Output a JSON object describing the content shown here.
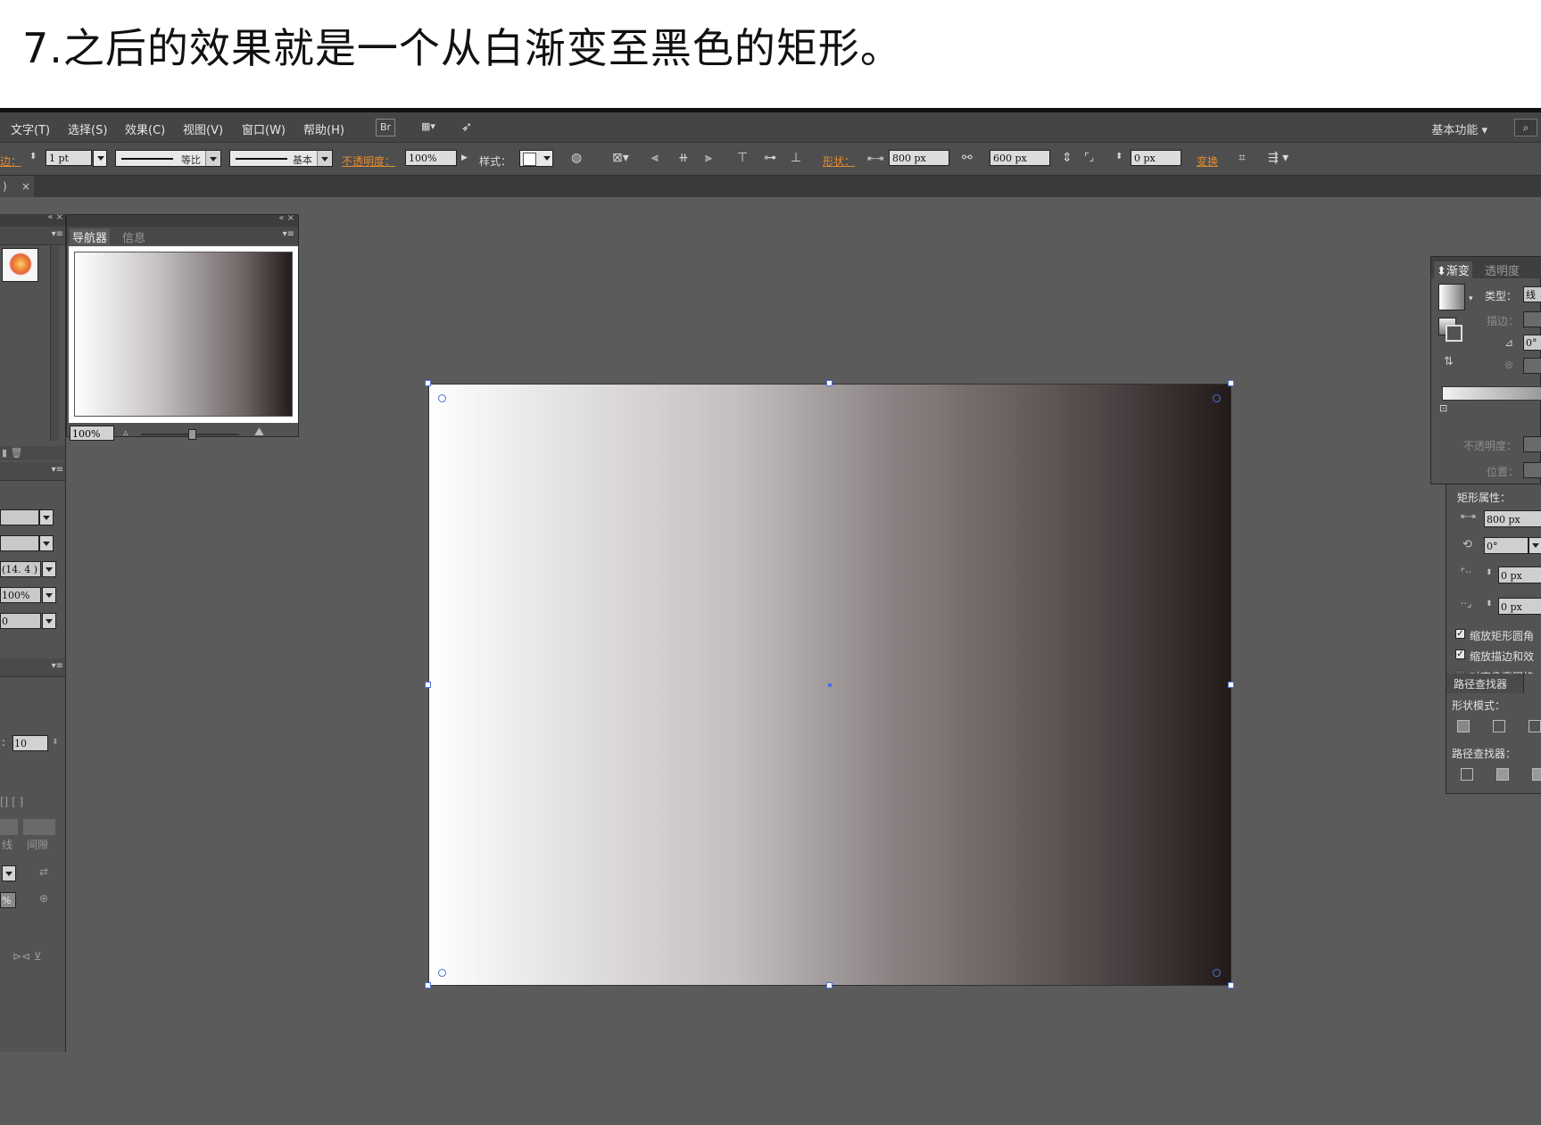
{
  "caption": "7.之后的效果就是一个从白渐变至黑色的矩形。",
  "menu": {
    "items": [
      "文字(T)",
      "选择(S)",
      "效果(C)",
      "视图(V)",
      "窗口(W)",
      "帮助(H)"
    ],
    "bridge": "Br",
    "workspace": "基本功能"
  },
  "control": {
    "stroke_label": "边：",
    "stroke_weight": "1 pt",
    "profile_label": "等比",
    "brush_label": "基本",
    "opacity_label": "不透明度：",
    "opacity_value": "100%",
    "style_label": "样式：",
    "shape_label": "形状：",
    "width": "800 px",
    "height": "600 px",
    "corner": "0 px",
    "transform_label": "变换"
  },
  "left_panel": {
    "field1": "(14. 4 )",
    "field2": "100%",
    "field3": "0",
    "field4": "10",
    "text1": "线",
    "text2": "间隙",
    "text3": "%"
  },
  "navigator": {
    "tab_navigator": "导航器",
    "tab_info": "信息",
    "zoom": "100%"
  },
  "gradient_panel": {
    "tab_gradient": "渐变",
    "tab_transparency": "透明度",
    "type_label": "类型：",
    "type_value": "线",
    "stroke_label": "描边：",
    "angle_value": "0°",
    "opacity_label": "不透明度：",
    "position_label": "位置："
  },
  "transform_panel": {
    "title": "矩形属性：",
    "width": "800 px",
    "angle": "0°",
    "corner1": "0 px",
    "corner2": "0 px",
    "check1": "缩放矩形圆角",
    "check2": "缩放描边和效",
    "check3": "对齐像素网格"
  },
  "pathfinder": {
    "tab": "路径查找器",
    "shape_modes": "形状模式：",
    "pathfinders": "路径查找器："
  }
}
